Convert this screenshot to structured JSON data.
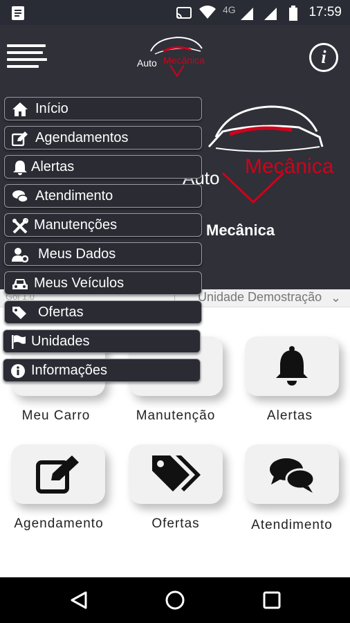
{
  "status_bar": {
    "time": "17:59",
    "network": "4G"
  },
  "header": {
    "logo_text_1": "Auto",
    "logo_text_2": "Mecânica"
  },
  "hero": {
    "brand_title": "Mecânica"
  },
  "unit_selector": {
    "left_hint": "Gol 1.0",
    "selected": "Unidade Demostração"
  },
  "menu": {
    "items": [
      {
        "label": "Início",
        "icon": "home-icon"
      },
      {
        "label": "Agendamentos",
        "icon": "edit-icon"
      },
      {
        "label": "Alertas",
        "icon": "bell-icon"
      },
      {
        "label": "Atendimento",
        "icon": "chat-icon"
      },
      {
        "label": "Manutenções",
        "icon": "tools-icon"
      },
      {
        "label": "Meus Dados",
        "icon": "user-gear-icon"
      },
      {
        "label": "Meus Veículos",
        "icon": "car-icon"
      },
      {
        "label": "Ofertas",
        "icon": "tags-icon"
      },
      {
        "label": "Unidades",
        "icon": "flag-icon"
      },
      {
        "label": "Informações",
        "icon": "info-icon"
      }
    ]
  },
  "grid": {
    "items": [
      {
        "label": "Meu Carro",
        "icon": "car-icon"
      },
      {
        "label": "Manutenção",
        "icon": "tools-icon"
      },
      {
        "label": "Alertas",
        "icon": "bell-icon"
      },
      {
        "label": "Agendamento",
        "icon": "edit-icon"
      },
      {
        "label": "Ofertas",
        "icon": "tags-icon"
      },
      {
        "label": "Atendimento",
        "icon": "chat-icon"
      }
    ]
  },
  "colors": {
    "header_bg": "#2f3038",
    "accent_red": "#d0021b",
    "menu_bg": "#2a2b33"
  }
}
